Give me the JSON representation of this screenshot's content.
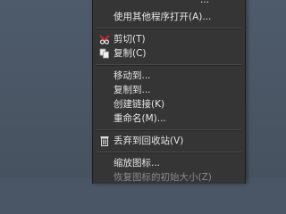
{
  "menu": {
    "items": [
      {
        "id": "partial_top",
        "label": "...",
        "disabled": false
      },
      {
        "id": "open_with",
        "label": "使用其他程序打开(A)...",
        "disabled": false
      },
      {
        "id": "cut",
        "label": "剪切(T)",
        "icon": "scissors-icon",
        "disabled": false
      },
      {
        "id": "copy",
        "label": "复制(C)",
        "icon": "copy-icon",
        "disabled": false
      },
      {
        "id": "move_to",
        "label": "移动到...",
        "disabled": false
      },
      {
        "id": "copy_to",
        "label": "复制到...",
        "disabled": false
      },
      {
        "id": "make_link",
        "label": "创建链接(K)",
        "disabled": false
      },
      {
        "id": "rename",
        "label": "重命名(M)...",
        "disabled": false
      },
      {
        "id": "trash",
        "label": "丢弃到回收站(V)",
        "icon": "trash-icon",
        "disabled": false
      },
      {
        "id": "scale_icon",
        "label": "缩放图标...",
        "disabled": false
      },
      {
        "id": "restore_icon_size",
        "label": "恢复图标的初始大小(Z)",
        "disabled": true
      }
    ]
  },
  "colors": {
    "menu_bg": "#353535",
    "text": "#e6e6e6",
    "disabled_text": "#8a8a8a",
    "desktop_bg": "#4a5666",
    "cut_icon_red": "#c62828"
  }
}
